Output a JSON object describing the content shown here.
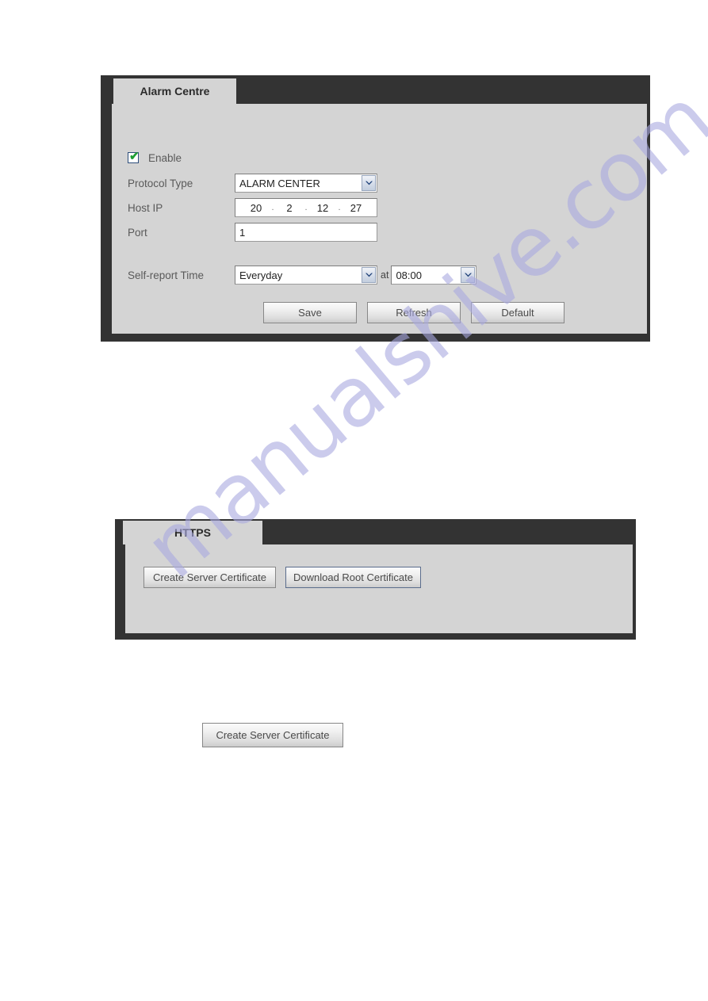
{
  "watermark": {
    "text": "manualshive.com",
    "color": "#a9a9e0"
  },
  "alarm_centre_panel": {
    "tab_label": "Alarm Centre",
    "enable": {
      "label": "Enable",
      "checked": true,
      "check_glyph": "✔",
      "check_color": "#1e9e32"
    },
    "fields": {
      "protocol_type": {
        "label": "Protocol Type",
        "value": "ALARM CENTER",
        "options": [
          "ALARM CENTER"
        ]
      },
      "host_ip": {
        "label": "Host IP",
        "octets": [
          "20",
          "2",
          "12",
          "27"
        ],
        "separator": "."
      },
      "port": {
        "label": "Port",
        "value": "1",
        "placeholder": ""
      },
      "self_report_time": {
        "label": "Self-report Time",
        "day_value": "Everyday",
        "day_options": [
          "Everyday"
        ],
        "at_label": "at",
        "time_value": "08:00",
        "time_options": [
          "08:00"
        ]
      }
    },
    "buttons": [
      {
        "label": "Save",
        "name": "save-button"
      },
      {
        "label": "Refresh",
        "name": "refresh-button"
      },
      {
        "label": "Default",
        "name": "default-button"
      }
    ]
  },
  "https_panel": {
    "tab_label": "HTTPS",
    "buttons": [
      {
        "label": "Create Server Certificate",
        "name": "create-server-certificate-button"
      },
      {
        "label": "Download Root Certificate",
        "name": "download-root-certificate-button"
      }
    ]
  },
  "standalone_button": {
    "label": "Create Server Certificate"
  }
}
